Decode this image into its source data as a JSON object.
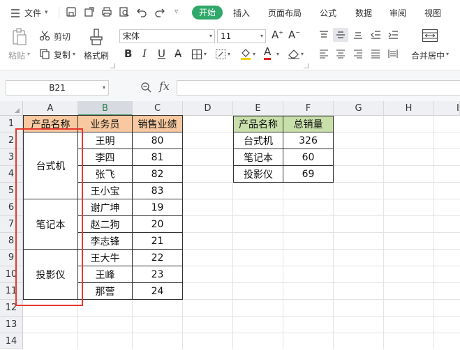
{
  "menu": {
    "file_label": "文件",
    "tabs": [
      "开始",
      "插入",
      "页面布局",
      "公式",
      "数据",
      "审阅",
      "视图"
    ]
  },
  "ribbon": {
    "paste": "粘贴",
    "cut": "剪切",
    "copy": "复制",
    "format_painter": "格式刷",
    "font_name": "宋体",
    "font_size": "11",
    "merge_center": "合并居中"
  },
  "formula_bar": {
    "name_box": "B21",
    "fx": "fx",
    "formula": ""
  },
  "sheet": {
    "columns": [
      "A",
      "B",
      "C",
      "D",
      "E",
      "F",
      "G",
      "H",
      "I"
    ],
    "rows": [
      "1",
      "2",
      "3",
      "4",
      "5",
      "6",
      "7",
      "8",
      "9",
      "10",
      "11",
      "12",
      "13",
      "14"
    ],
    "table1": {
      "headers": [
        "产品名称",
        "业务员",
        "销售业绩"
      ],
      "groups": [
        "台式机",
        "笔记本",
        "投影仪"
      ],
      "salespeople": [
        "王明",
        "李四",
        "张飞",
        "王小宝",
        "谢广坤",
        "赵二狗",
        "李志锋",
        "王大牛",
        "王峰",
        "那营"
      ],
      "sales": [
        "80",
        "81",
        "82",
        "83",
        "19",
        "20",
        "21",
        "22",
        "23",
        "24"
      ]
    },
    "table2": {
      "headers": [
        "产品名称",
        "总销量"
      ],
      "products": [
        "台式机",
        "笔记本",
        "投影仪"
      ],
      "totals": [
        "326",
        "60",
        "69"
      ]
    }
  },
  "colors": {
    "accent_green": "#2fa86a",
    "header_orange": "#f8c9a0",
    "header_green": "#c8dfaa",
    "selection_red": "#e8382f",
    "selected_col": "#4f9a6b"
  }
}
